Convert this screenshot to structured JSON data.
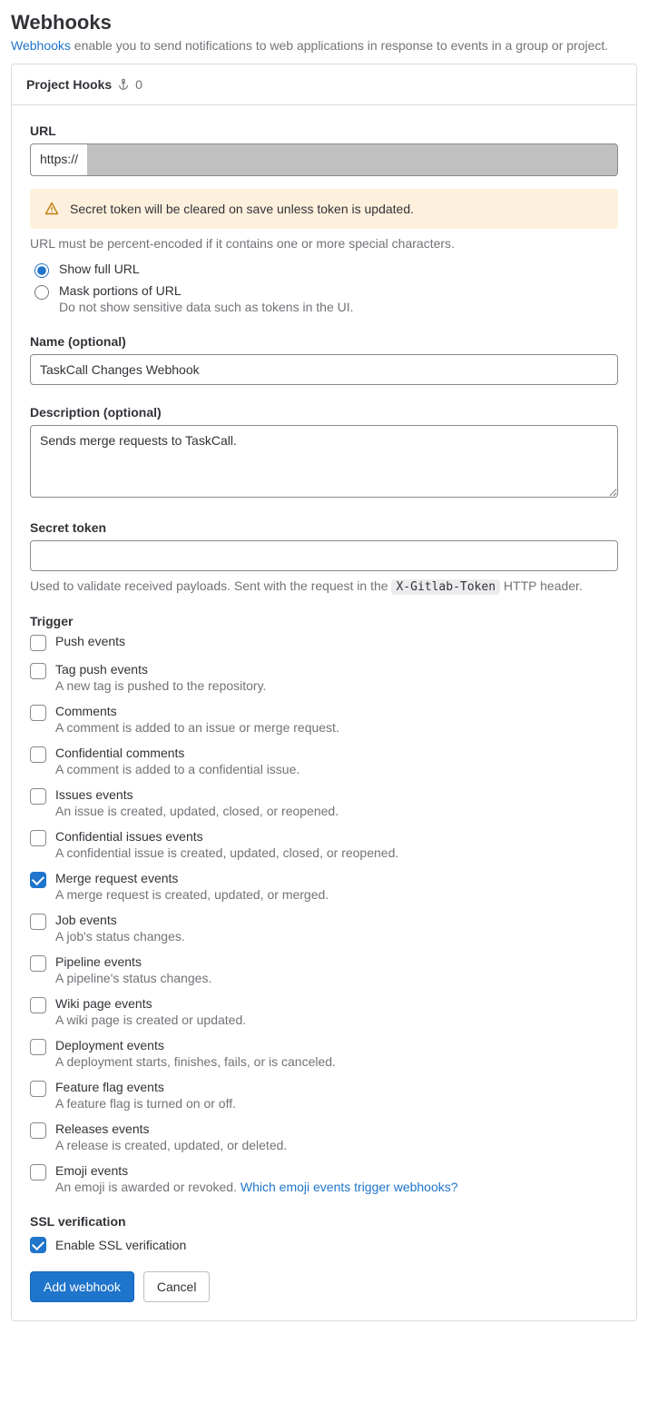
{
  "page": {
    "title": "Webhooks",
    "subtitle_link": "Webhooks",
    "subtitle_rest": " enable you to send notifications to web applications in response to events in a group or project."
  },
  "panel": {
    "title": "Project Hooks",
    "count": "0"
  },
  "url": {
    "label": "URL",
    "prefix": "https://",
    "alert": "Secret token will be cleared on save unless token is updated.",
    "help": "URL must be percent-encoded if it contains one or more special characters.",
    "radio_full": "Show full URL",
    "radio_mask": "Mask portions of URL",
    "mask_desc": "Do not show sensitive data such as tokens in the UI."
  },
  "name": {
    "label": "Name (optional)",
    "value": "TaskCall Changes Webhook"
  },
  "description": {
    "label": "Description (optional)",
    "value": "Sends merge requests to TaskCall."
  },
  "secret": {
    "label": "Secret token",
    "value": "",
    "help_pre": "Used to validate received payloads. Sent with the request in the ",
    "help_code": "X-Gitlab-Token",
    "help_post": " HTTP header."
  },
  "trigger_heading": "Trigger",
  "triggers": [
    {
      "label": "Push events",
      "desc": "",
      "checked": false
    },
    {
      "label": "Tag push events",
      "desc": "A new tag is pushed to the repository.",
      "checked": false
    },
    {
      "label": "Comments",
      "desc": "A comment is added to an issue or merge request.",
      "checked": false
    },
    {
      "label": "Confidential comments",
      "desc": "A comment is added to a confidential issue.",
      "checked": false
    },
    {
      "label": "Issues events",
      "desc": "An issue is created, updated, closed, or reopened.",
      "checked": false
    },
    {
      "label": "Confidential issues events",
      "desc": "A confidential issue is created, updated, closed, or reopened.",
      "checked": false
    },
    {
      "label": "Merge request events",
      "desc": "A merge request is created, updated, or merged.",
      "checked": true
    },
    {
      "label": "Job events",
      "desc": "A job's status changes.",
      "checked": false
    },
    {
      "label": "Pipeline events",
      "desc": "A pipeline's status changes.",
      "checked": false
    },
    {
      "label": "Wiki page events",
      "desc": "A wiki page is created or updated.",
      "checked": false
    },
    {
      "label": "Deployment events",
      "desc": "A deployment starts, finishes, fails, or is canceled.",
      "checked": false
    },
    {
      "label": "Feature flag events",
      "desc": "A feature flag is turned on or off.",
      "checked": false
    },
    {
      "label": "Releases events",
      "desc": "A release is created, updated, or deleted.",
      "checked": false
    },
    {
      "label": "Emoji events",
      "desc": "An emoji is awarded or revoked. ",
      "checked": false,
      "link": "Which emoji events trigger webhooks?"
    }
  ],
  "ssl": {
    "heading": "SSL verification",
    "label": "Enable SSL verification",
    "checked": true
  },
  "buttons": {
    "primary": "Add webhook",
    "secondary": "Cancel"
  }
}
